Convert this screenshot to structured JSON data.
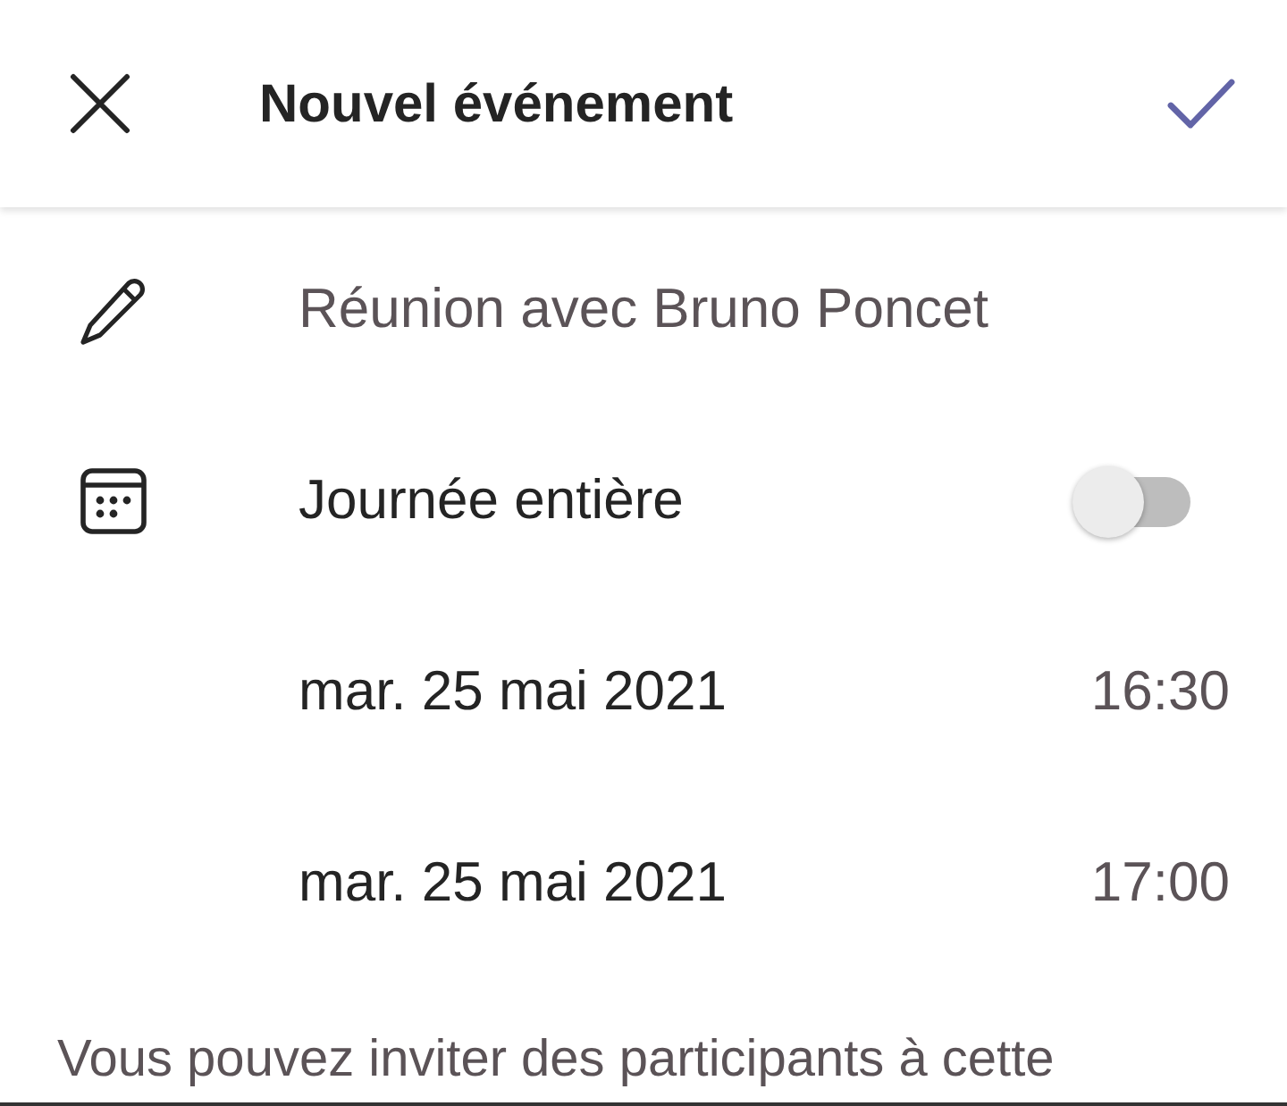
{
  "header": {
    "title": "Nouvel événement"
  },
  "title_field": {
    "value": "Réunion avec Bruno Poncet"
  },
  "all_day": {
    "label": "Journée entière",
    "on": false
  },
  "date_rows": [
    {
      "date": "mar. 25 mai 2021",
      "time": "16:30"
    },
    {
      "date": "mar. 25 mai 2021",
      "time": "17:00"
    }
  ],
  "note": "Vous pouvez inviter des participants à cette"
}
